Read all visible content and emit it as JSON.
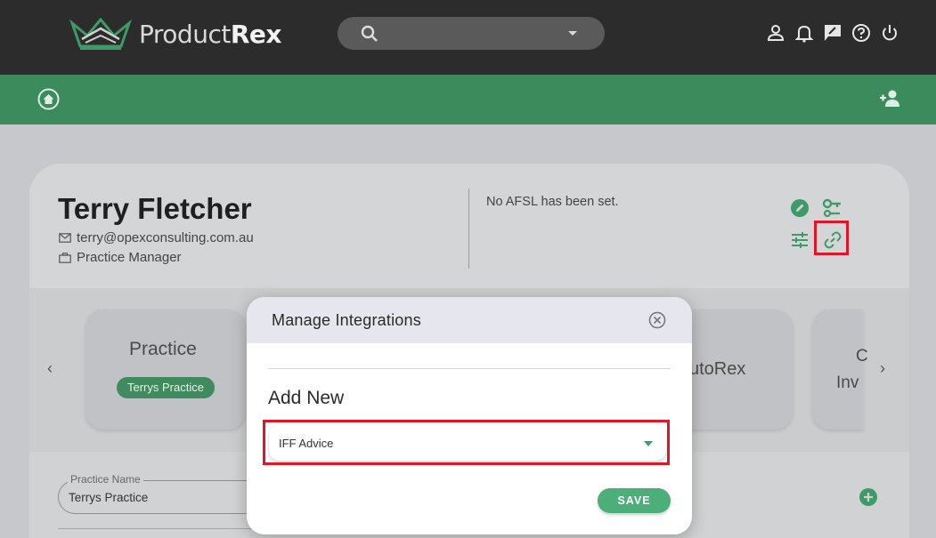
{
  "brand": {
    "name_light": "Product",
    "name_bold": "Rex"
  },
  "colors": {
    "accent_green": "#3c8b5d",
    "highlight_red": "#e01525",
    "topbar": "#2c2c2c"
  },
  "header": {
    "icons": [
      "user-icon",
      "bell-icon",
      "feedback-icon",
      "help-icon",
      "power-icon"
    ]
  },
  "subnav": {
    "icons": [
      "home-icon",
      "add-user-icon"
    ]
  },
  "profile": {
    "name": "Terry Fletcher",
    "email": "terry@opexconsulting.com.au",
    "role": "Practice Manager",
    "afsl": "No AFSL has been set."
  },
  "tiles": [
    {
      "title": "Practice",
      "chip": "Terrys Practice"
    },
    {
      "title": "utoRex"
    },
    {
      "title": "C",
      "subtitle": "Inv"
    }
  ],
  "form": {
    "practice_name_label": "Practice Name",
    "practice_name_value": "Terrys Practice"
  },
  "modal": {
    "title": "Manage Integrations",
    "section": "Add New",
    "selected": "IFF Advice",
    "save_label": "SAVE"
  }
}
